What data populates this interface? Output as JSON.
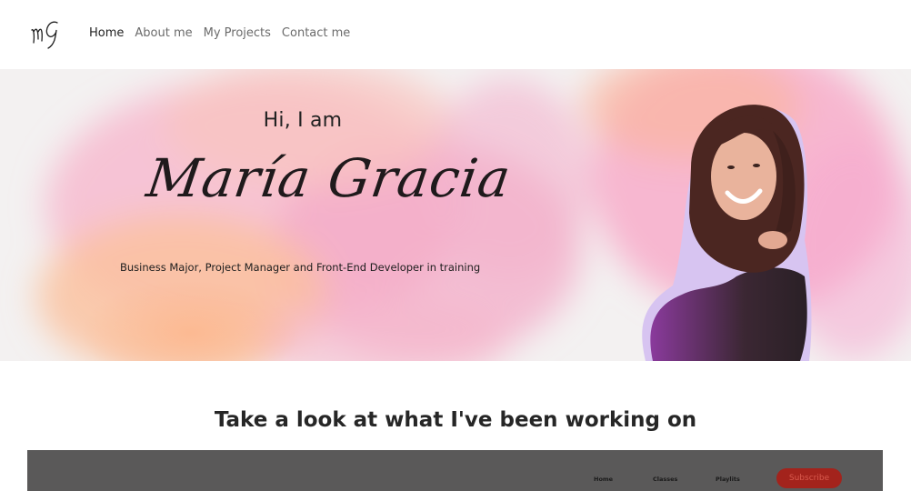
{
  "brand": {
    "logo_text": "MG"
  },
  "nav": {
    "items": [
      {
        "label": "Home",
        "active": true
      },
      {
        "label": "About me",
        "active": false
      },
      {
        "label": "My Projects",
        "active": false
      },
      {
        "label": "Contact me",
        "active": false
      }
    ]
  },
  "hero": {
    "greeting": "Hi, I am",
    "name": "María Gracia",
    "subtitle": "Business Major, Project Manager and Front-End Developer in training"
  },
  "projects": {
    "title": "Take a look at what I've been working on",
    "preview": {
      "nav": [
        "Home",
        "Classes",
        "Playlits"
      ],
      "button_label": "Subscribe"
    }
  },
  "colors": {
    "hero_background": "#f3f1f1",
    "watercolor_pink": "#f5a9c8",
    "watercolor_peach": "#fbbf93",
    "preview_background": "#5a5959",
    "subscribe_button": "#a3231c"
  }
}
